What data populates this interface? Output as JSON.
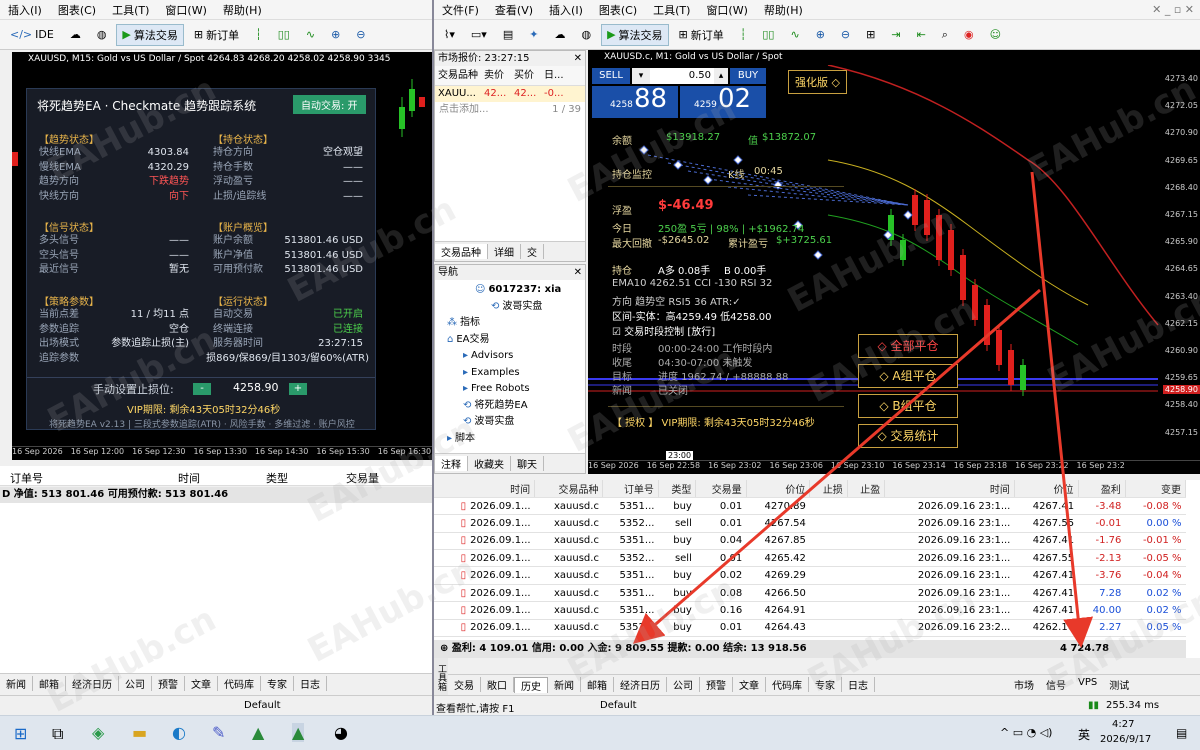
{
  "left": {
    "menu": [
      "插入(I)",
      "图表(C)",
      "工具(T)",
      "窗口(W)",
      "帮助(H)"
    ],
    "toolbar": [
      "IDE",
      "算法交易",
      "新订单"
    ],
    "chart_title": "XAUUSD, M15: Gold vs US Dollar / Spot 4264.83 4268.20 4258.02 4258.90 3345",
    "yticks": [],
    "xticks": [
      "16 Sep 2026",
      "16 Sep 12:00",
      "16 Sep 12:30",
      "16 Sep 13:30",
      "16 Sep 14:30",
      "16 Sep 15:30",
      "16 Sep 16:30",
      "16 Sep 17:30",
      "16 Sep 18:30"
    ],
    "ea": {
      "title": "将死趋势EA · Checkmate 趋势跟踪系统",
      "auto_btn": "自动交易: 开",
      "trend_title": "【趋势状态】",
      "trend": [
        [
          "快线EMA",
          "4303.84"
        ],
        [
          "慢线EMA",
          "4320.29"
        ],
        [
          "趋势方向",
          "下跌趋势"
        ],
        [
          "快线方向",
          "向下"
        ]
      ],
      "pos_title": "【持仓状态】",
      "pos": [
        [
          "持仓方向",
          "空仓观望"
        ],
        [
          "持仓手数",
          "——"
        ],
        [
          "浮动盈亏",
          "——"
        ],
        [
          "止损/追踪线",
          "——"
        ]
      ],
      "sig_title": "【信号状态】",
      "sig": [
        [
          "多头信号",
          "——"
        ],
        [
          "空头信号",
          "——"
        ],
        [
          "最近信号",
          "暂无"
        ]
      ],
      "acct_title": "【账户概览】",
      "acct": [
        [
          "账户余额",
          "513801.46 USD"
        ],
        [
          "账户净值",
          "513801.46 USD"
        ],
        [
          "可用预付款",
          "513801.46 USD"
        ]
      ],
      "strat_title": "【策略参数】",
      "strat": [
        [
          "当前点差",
          "11 / 均11 点"
        ],
        [
          "参数追踪",
          "空仓"
        ],
        [
          "出场模式",
          "参数追踪止损(主)"
        ],
        [
          "追踪参数",
          "损869/保869/目1303/留60%(ATR)"
        ]
      ],
      "run_title": "【运行状态】",
      "run": [
        [
          "自动交易",
          "已开启"
        ],
        [
          "终端连接",
          "已连接"
        ],
        [
          "服务器时间",
          "23:27:15"
        ]
      ],
      "manual_label": "手动设置止损位:",
      "minus": "-",
      "manual_value": "4258.90",
      "plus": "+",
      "vip": "VIP期限: 剩余43天05时32分46秒",
      "footer": "将死趋势EA v2.13 | 三段式参数追踪(ATR) · 风险手数 · 多维过滤 · 账户风控"
    },
    "bottom_header": [
      "订单号",
      "时间",
      "类型",
      "交易量"
    ],
    "balance_line": "D  净值: 513 801.46  可用预付款: 513 801.46",
    "tabs": [
      "新闻",
      "邮箱",
      "经济日历",
      "公司",
      "预警",
      "文章",
      "代码库",
      "专家",
      "日志"
    ],
    "status": "Default"
  },
  "right": {
    "menu": [
      "文件(F)",
      "查看(V)",
      "插入(I)",
      "图表(C)",
      "工具(T)",
      "窗口(W)",
      "帮助(H)"
    ],
    "toolbar": [
      "算法交易",
      "新订单"
    ],
    "market_watch": {
      "title": "市场报价: 23:27:15",
      "cols": [
        "交易品种",
        "卖价",
        "买价",
        "日..."
      ],
      "row": [
        "XAUU...",
        "42...",
        "42...",
        "-0..."
      ],
      "add": "点击添加...",
      "count": "1 / 39",
      "tabs": [
        "交易品种",
        "详细",
        "交"
      ]
    },
    "navigator": {
      "title": "导航",
      "items": [
        "6017237: xia",
        "波哥实盘",
        "指标",
        "EA交易",
        "Advisors",
        "Examples",
        "Free Robots",
        "将死趋势EA",
        "波哥实盘",
        "脚本"
      ],
      "tabs": [
        "注释",
        "收藏夹",
        "聊天"
      ]
    },
    "chart_title": "XAUUSD.c, M1: Gold vs US Dollar / Spot",
    "trade_panel": {
      "sell": "SELL",
      "buy": "BUY",
      "lot": "0.50",
      "sell_small": "4258",
      "sell_big": "88",
      "buy_small": "4259",
      "buy_big": "02"
    },
    "yticks": [
      "4273.40",
      "4272.05",
      "4270.90",
      "4269.65",
      "4268.40",
      "4267.15",
      "4265.90",
      "4264.65",
      "4263.40",
      "4262.15",
      "4260.90",
      "4259.65",
      "4258.40",
      "4257.15"
    ],
    "xticks": [
      "16 Sep 2026",
      "16 Sep 22:58",
      "16 Sep 23:02",
      "16 Sep 23:06",
      "16 Sep 23:10",
      "16 Sep 23:14",
      "16 Sep 23:18",
      "16 Sep 23:22",
      "16 Sep 23:2"
    ],
    "price_tag": "4258.90",
    "time_tag": "23:00",
    "overlay": {
      "header": "强化版 ◇",
      "balance_label": "余额",
      "balance_value": "$13918.27",
      "value_label": "值",
      "value_value": "$13872.07",
      "monitor": "持仓监控",
      "k_label": "K线",
      "k_value": "00:45",
      "float_label": "浮盈",
      "float_value": "$-46.49",
      "today_label": "今日",
      "today_value": "250盈 5亏 | 98% | +$1962.74",
      "dd_label": "最大回撤",
      "dd_value": "-$2645.02",
      "acc_label": "累计盈亏",
      "acc_value": "$+3725.61",
      "pos_label": "持仓",
      "pos_a": "A多 0.08手",
      "pos_b": "B 0.00手",
      "ind": "EMA10 4262.51   CCI -130   RSI 32",
      "dir": "方向 趋势空   RSI5 36   ATR:✓",
      "range": "区间-实体：高4259.49 低4258.00",
      "period": "☑ 交易时段控制 [放行]",
      "t1l": "时段",
      "t1v": "00:00-24:00 工作时段内",
      "t2l": "收尾",
      "t2v": "04:30-07:00 未触发",
      "t3l": "目标",
      "t3v": "进度 1962.74 / +88888.88",
      "t4l": "新闻",
      "t4v": "已关闭",
      "auth": "【 授权 】   VIP期限: 剩余43天05时32分46秒",
      "btns": [
        "◇  全部平仓",
        "◇  A组平仓",
        "◇  B组平仓",
        "◇  交易统计"
      ]
    },
    "orders": {
      "cols": [
        "时间",
        "交易品种",
        "订单号",
        "类型",
        "交易量",
        "价位",
        "止损",
        "止盈",
        "时间",
        "价位",
        "盈利",
        "变更"
      ],
      "rows": [
        [
          "2026.09.1...",
          "xauusd.c",
          "5351...",
          "buy",
          "0.01",
          "4270.89",
          "",
          "",
          "2026.09.16 23:1...",
          "4267.41",
          "-3.48",
          "-0.08 %"
        ],
        [
          "2026.09.1...",
          "xauusd.c",
          "5352...",
          "sell",
          "0.01",
          "4267.54",
          "",
          "",
          "2026.09.16 23:1...",
          "4267.55",
          "-0.01",
          "0.00 %"
        ],
        [
          "2026.09.1...",
          "xauusd.c",
          "5351...",
          "buy",
          "0.04",
          "4267.85",
          "",
          "",
          "2026.09.16 23:1...",
          "4267.41",
          "-1.76",
          "-0.01 %"
        ],
        [
          "2026.09.1...",
          "xauusd.c",
          "5352...",
          "sell",
          "0.01",
          "4265.42",
          "",
          "",
          "2026.09.16 23:1...",
          "4267.55",
          "-2.13",
          "-0.05 %"
        ],
        [
          "2026.09.1...",
          "xauusd.c",
          "5351...",
          "buy",
          "0.02",
          "4269.29",
          "",
          "",
          "2026.09.16 23:1...",
          "4267.41",
          "-3.76",
          "-0.04 %"
        ],
        [
          "2026.09.1...",
          "xauusd.c",
          "5351...",
          "buy",
          "0.08",
          "4266.50",
          "",
          "",
          "2026.09.16 23:1...",
          "4267.41",
          "7.28",
          "0.02 %"
        ],
        [
          "2026.09.1...",
          "xauusd.c",
          "5351...",
          "buy",
          "0.16",
          "4264.91",
          "",
          "",
          "2026.09.16 23:1...",
          "4267.41",
          "40.00",
          "0.02 %"
        ],
        [
          "2026.09.1...",
          "xauusd.c",
          "5352...",
          "buy",
          "0.01",
          "4264.43",
          "",
          "",
          "2026.09.16 23:2...",
          "4262.16",
          "2.27",
          "0.05 %"
        ]
      ],
      "summary": "盈利: 4 109.01  信用: 0.00  入金: 9 809.55  提款: 0.00  结余: 13 918.56",
      "total": "4 724.78"
    },
    "tabs": [
      "交易",
      "敞口",
      "历史",
      "新闻",
      "邮箱",
      "经济日历",
      "公司",
      "预警",
      "文章",
      "代码库",
      "专家",
      "日志"
    ],
    "right_tabs": [
      "市场",
      "信号",
      "VPS",
      "测试"
    ],
    "side_label": "工具箱",
    "status_left": "查看帮忙,请按 F1",
    "status_mid": "Default",
    "status_right": "255.34 ms"
  },
  "taskbar": {
    "time": "4:27",
    "date": "2026/9/17",
    "lang": "英"
  },
  "watermark": "EAHub.cn"
}
